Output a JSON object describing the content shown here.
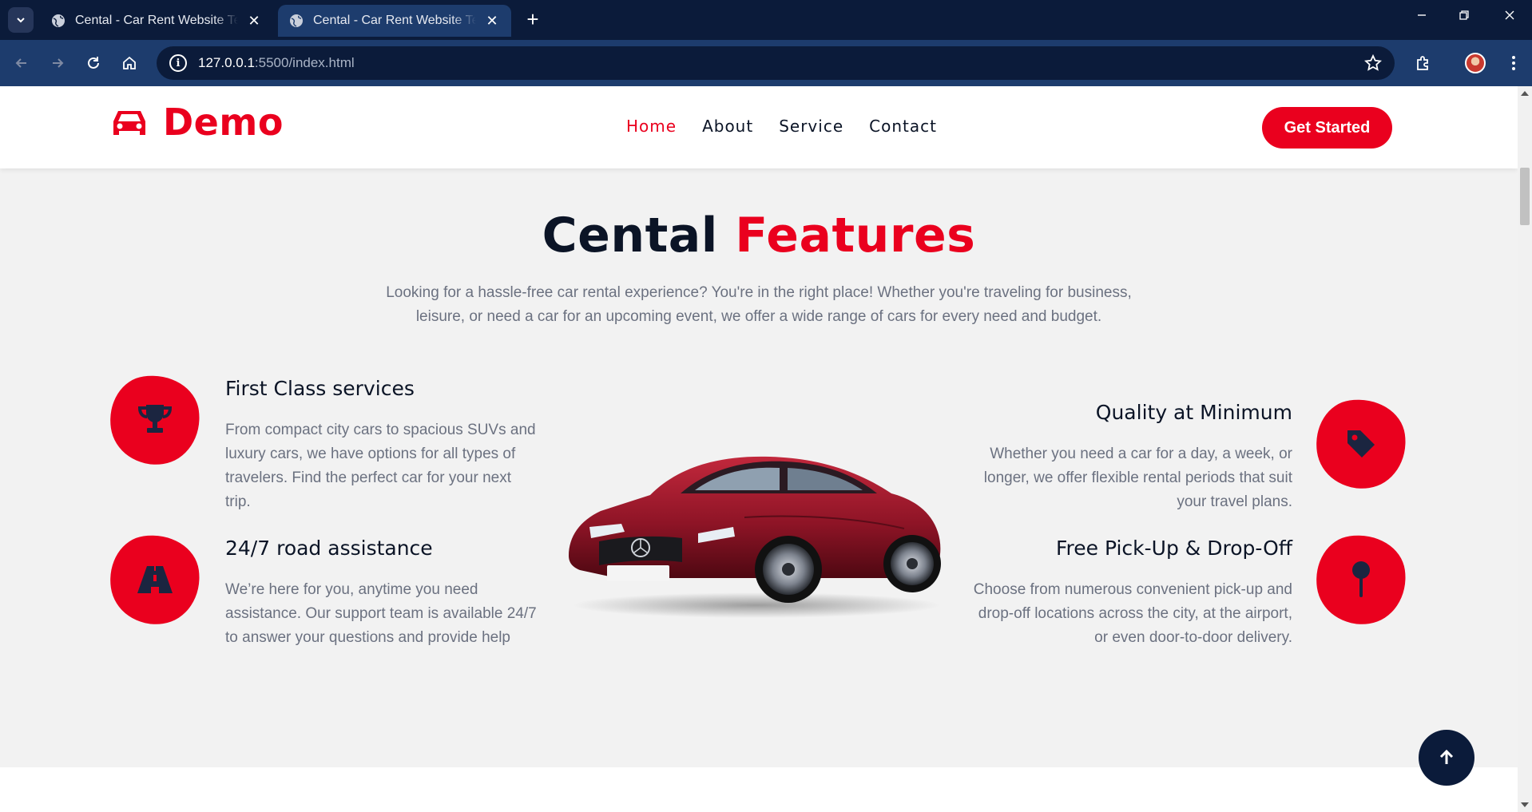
{
  "browser": {
    "tabs": [
      {
        "title": "Cental - Car Rent Website Template"
      },
      {
        "title": "Cental - Car Rent Website Template"
      }
    ],
    "url_host": "127.0.0.1",
    "url_rest": ":5500/index.html"
  },
  "header": {
    "logo_text": "Demo",
    "nav": [
      {
        "label": "Home",
        "active": true
      },
      {
        "label": "About"
      },
      {
        "label": "Service"
      },
      {
        "label": "Contact"
      }
    ],
    "cta_label": "Get Started"
  },
  "features": {
    "title_dark": "Cental",
    "title_red": "Features",
    "description_line1": "Looking for a hassle-free car rental experience? You're in the right place! Whether you're traveling for business,",
    "description_line2": "leisure, or need a car for an upcoming event, we offer a wide range of cars for every need and budget.",
    "left": [
      {
        "title": "First Class services",
        "icon": "trophy-icon",
        "text": "From compact city cars to spacious SUVs and luxury cars, we have options for all types of travelers. Find the perfect car for your next trip."
      },
      {
        "title": "24/7 road assistance",
        "icon": "road-icon",
        "text": "We’re here for you, anytime you need assistance. Our support team is available 24/7 to answer your questions and provide help"
      }
    ],
    "right": [
      {
        "title": "Quality at Minimum",
        "icon": "tag-icon",
        "text": "Whether you need a car for a day, a week, or longer, we offer flexible rental periods that suit your travel plans."
      },
      {
        "title": "Free Pick-Up & Drop-Off",
        "icon": "map-pin-icon",
        "text": "Choose from numerous convenient pick-up and drop-off locations across the city, at the airport, or even door-to-door delivery."
      }
    ]
  },
  "colors": {
    "accent": "#ea001e",
    "dark": "#0b1426",
    "muted": "#6b7180"
  }
}
